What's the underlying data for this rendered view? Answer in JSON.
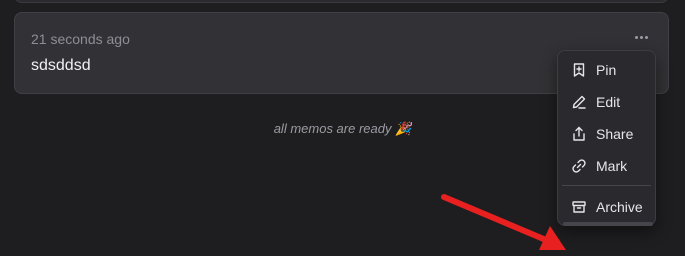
{
  "memo": {
    "time": "21 seconds ago",
    "content": "sdsddsd"
  },
  "status_text": "all memos are ready 🎉",
  "menu": {
    "items": [
      {
        "label": "Pin",
        "icon": "pin-bookmark-icon"
      },
      {
        "label": "Edit",
        "icon": "pencil-icon"
      },
      {
        "label": "Share",
        "icon": "share-icon"
      },
      {
        "label": "Mark",
        "icon": "link-icon"
      },
      {
        "label": "Archive",
        "icon": "archive-icon"
      }
    ]
  },
  "annotation": {
    "color": "#e8201f"
  }
}
